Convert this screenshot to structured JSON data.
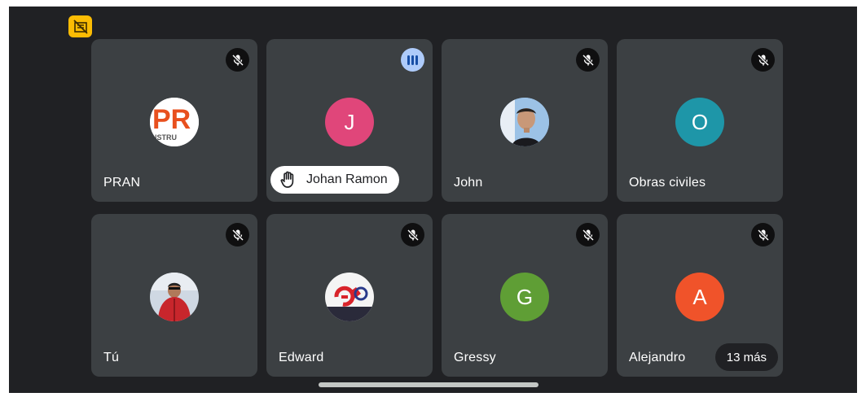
{
  "screen": {
    "status_icon": "no-video-sync-icon",
    "home_indicator": "gesture-bar"
  },
  "participants": [
    {
      "name": "PRAN",
      "avatar": {
        "type": "image",
        "desc": "logo-orange",
        "letters": "PR",
        "caption": "NSTRU"
      },
      "mic": "muted"
    },
    {
      "name": "Johan Ramon",
      "avatar": {
        "type": "initial",
        "letter": "J",
        "color": "#e0467a"
      },
      "mic": "speaking",
      "hand_raised": true
    },
    {
      "name": "John",
      "avatar": {
        "type": "image",
        "desc": "person-photo"
      },
      "mic": "muted"
    },
    {
      "name": "Obras civiles",
      "avatar": {
        "type": "initial",
        "letter": "O",
        "color": "#1e96a8"
      },
      "mic": "muted"
    },
    {
      "name": "Tú",
      "avatar": {
        "type": "image",
        "desc": "person-red-jacket"
      },
      "mic": "muted"
    },
    {
      "name": "Edward",
      "avatar": {
        "type": "image",
        "desc": "logo-g"
      },
      "mic": "muted"
    },
    {
      "name": "Gressy",
      "avatar": {
        "type": "initial",
        "letter": "G",
        "color": "#5f9e35"
      },
      "mic": "muted"
    },
    {
      "name": "Alejandro",
      "avatar": {
        "type": "initial",
        "letter": "A",
        "color": "#f0532a"
      },
      "mic": "muted"
    }
  ],
  "more_chip": "13 más",
  "colors": {
    "background": "#202124",
    "tile": "#3c4043",
    "status_badge": "#fbbc04",
    "speaking_indicator": "#aecbfa"
  }
}
